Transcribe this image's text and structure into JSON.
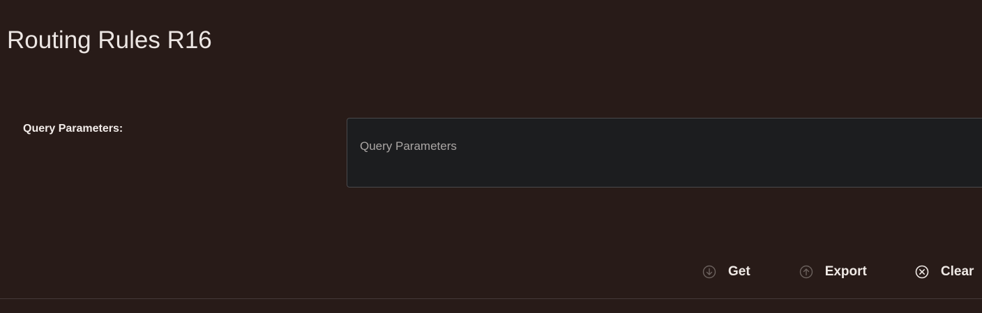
{
  "page": {
    "title": "Routing Rules R16"
  },
  "query": {
    "label": "Query Parameters:",
    "placeholder": "Query Parameters",
    "value": ""
  },
  "toolbar": {
    "get": {
      "label": "Get",
      "icon": "download-circle-icon",
      "enabled": false
    },
    "export": {
      "label": "Export",
      "icon": "upload-circle-icon",
      "enabled": false
    },
    "clear": {
      "label": "Clear",
      "icon": "close-circle-icon",
      "enabled": true
    }
  },
  "colors": {
    "background": "#281b18",
    "input_background": "#1c1d1f",
    "text": "#f0eae6",
    "disabled_icon": "#6c625e"
  }
}
